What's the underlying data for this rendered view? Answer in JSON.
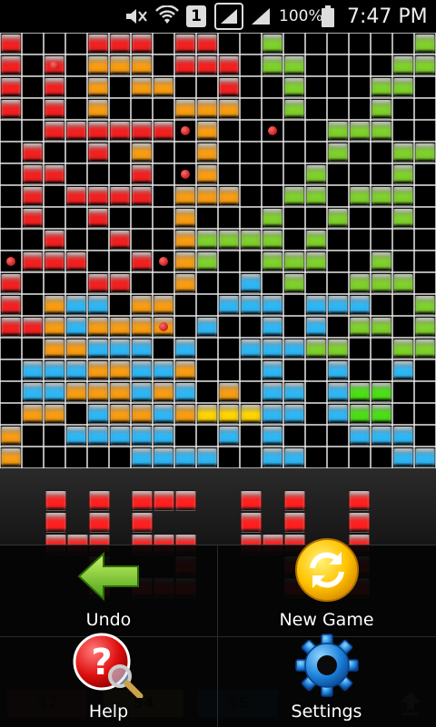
{
  "status_bar": {
    "battery_percent": "100%",
    "time": "7:47 PM",
    "sim_slot": "1"
  },
  "board": {
    "columns": 20,
    "rows": 20,
    "legend": {
      "R": "red",
      "O": "orange",
      "G": "green",
      "B": "blue",
      "Y": "bright-yellow",
      "P": "bright-green",
      "X": "empty"
    },
    "grid": [
      "RXXXRRRXRRXXGXXXXXXG",
      "RXRXOOOXRRRXGGXXXXGG",
      "RXRXOXOOXXRXXGXXXGGX",
      "RXRXOXXXOOOXXGXXXGXX",
      "XXRRRRRRXOXXXXXGGGXX",
      "XRXXRXOXXOXXXXXGXXGG",
      "XRRXXXRXXOXXXXGXXXGX",
      "XRXRRRRXOOOXXGGXGGGX",
      "XRXXRXXXOXXXGXXGXXGX",
      "XXRXXRXXOGGGGXGXXXXX",
      "XRRRXXRXOGXXGGGXXGXX",
      "RXXXRRXXOXXBXGXXGGGX",
      "RXOBBXOOXXBBBXBBBXXG",
      "RROBOOOOXBXXBXBXGGXG",
      "XXOOBBBXBXXBBBGGXXGG",
      "XBBBOOBBOXXXBXXBXXBX",
      "XBBOOOBOBXOXBBXBPPXX",
      "XOOXBOOBOYYYBBXBPPXX",
      "OXXBBBBBXXBXBXXXBBBX",
      "OXXXXXBBBBXXBBXXXXBB"
    ],
    "dots": [
      [
        1,
        2
      ],
      [
        4,
        8
      ],
      [
        4,
        12
      ],
      [
        6,
        8
      ],
      [
        10,
        0
      ],
      [
        10,
        7
      ],
      [
        13,
        7
      ]
    ]
  },
  "preview_digits": [
    {
      "digit": "4",
      "color": "#ff2020"
    },
    {
      "digit": "5",
      "color": "#ff2020"
    },
    {
      "digit": "4",
      "color": "#ff2020"
    },
    {
      "digit": "1",
      "color": "#ff2020"
    }
  ],
  "menu": {
    "items": [
      {
        "label": "Undo",
        "icon": "undo-arrow-icon"
      },
      {
        "label": "New Game",
        "icon": "new-game-refresh-icon"
      },
      {
        "label": "Help",
        "icon": "help-magnifier-icon"
      },
      {
        "label": "Settings",
        "icon": "settings-gear-icon"
      }
    ]
  },
  "scores": [
    {
      "value": "47",
      "color": "#ff6a3a"
    },
    {
      "value": "54",
      "color": "#ffd23a"
    },
    {
      "value": "55",
      "color": "#35b4ff"
    }
  ],
  "colors": {
    "red": "#f22020",
    "orange": "#f89c12",
    "green": "#7fd12b",
    "blue": "#2fb7f5",
    "bright-yellow": "#ffd400",
    "bright-green": "#4be015",
    "accent-yellow": "#ffcf00"
  }
}
